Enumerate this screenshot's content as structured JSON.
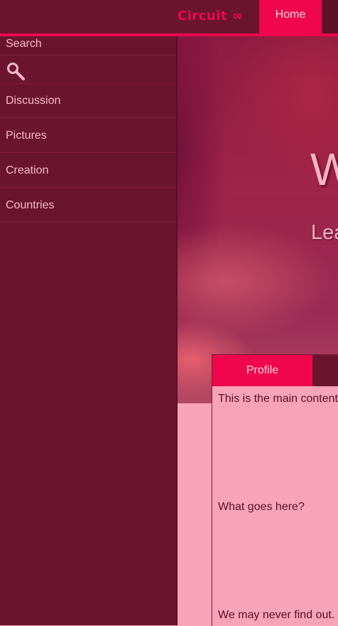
{
  "header": {
    "brand": "Circuit ∞",
    "nav": [
      {
        "label": "Home",
        "active": true
      }
    ]
  },
  "sidebar": {
    "search_label": "Search",
    "search_icon": "search-icon",
    "items": [
      {
        "label": "Discussion"
      },
      {
        "label": "Pictures"
      },
      {
        "label": "Creation"
      },
      {
        "label": "Countries"
      }
    ]
  },
  "hero": {
    "title": "W",
    "subtitle": "Lea"
  },
  "panel": {
    "tabs": [
      {
        "label": "Profile",
        "active": true
      }
    ],
    "lines": [
      "This is the main content o",
      "What goes here?",
      "We may never find out."
    ]
  },
  "colors": {
    "accent": "#f0064d",
    "sidebar_bg": "#6b1430",
    "page_bg": "#f9a3bb",
    "text_light": "#f7b8c9"
  }
}
